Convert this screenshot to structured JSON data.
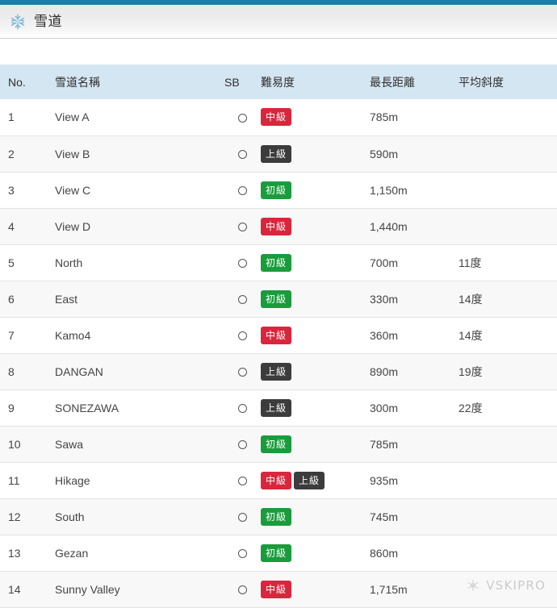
{
  "page": {
    "accent_color": "#1b7fa8",
    "section_title": "雪道",
    "section_icon": "snowflake-icon"
  },
  "table": {
    "columns": [
      {
        "key": "no",
        "label": "No."
      },
      {
        "key": "name",
        "label": "雪道名稱"
      },
      {
        "key": "sb",
        "label": "SB"
      },
      {
        "key": "diff",
        "label": "難易度"
      },
      {
        "key": "dist",
        "label": "最長距離"
      },
      {
        "key": "slope",
        "label": "平均斜度"
      }
    ],
    "header_bg": "#d4e6f2",
    "levels": {
      "beginner": {
        "label": "初級",
        "color": "#1a9c3c"
      },
      "intermediate": {
        "label": "中級",
        "color": "#d9263c"
      },
      "advanced": {
        "label": "上級",
        "color": "#3c3c3c"
      }
    },
    "sb_mark": "○",
    "rows": [
      {
        "no": "1",
        "name": "View A",
        "sb": "○",
        "levels": [
          "intermediate"
        ],
        "dist": "785m",
        "slope": ""
      },
      {
        "no": "2",
        "name": "View B",
        "sb": "○",
        "levels": [
          "advanced"
        ],
        "dist": "590m",
        "slope": ""
      },
      {
        "no": "3",
        "name": "View C",
        "sb": "○",
        "levels": [
          "beginner"
        ],
        "dist": "1,150m",
        "slope": ""
      },
      {
        "no": "4",
        "name": "View D",
        "sb": "○",
        "levels": [
          "intermediate"
        ],
        "dist": "1,440m",
        "slope": ""
      },
      {
        "no": "5",
        "name": "North",
        "sb": "○",
        "levels": [
          "beginner"
        ],
        "dist": "700m",
        "slope": "11度"
      },
      {
        "no": "6",
        "name": "East",
        "sb": "○",
        "levels": [
          "beginner"
        ],
        "dist": "330m",
        "slope": "14度"
      },
      {
        "no": "7",
        "name": "Kamo4",
        "sb": "○",
        "levels": [
          "intermediate"
        ],
        "dist": "360m",
        "slope": "14度"
      },
      {
        "no": "8",
        "name": "DANGAN",
        "sb": "○",
        "levels": [
          "advanced"
        ],
        "dist": "890m",
        "slope": "19度"
      },
      {
        "no": "9",
        "name": "SONEZAWA",
        "sb": "○",
        "levels": [
          "advanced"
        ],
        "dist": "300m",
        "slope": "22度"
      },
      {
        "no": "10",
        "name": "Sawa",
        "sb": "○",
        "levels": [
          "beginner"
        ],
        "dist": "785m",
        "slope": ""
      },
      {
        "no": "11",
        "name": "Hikage",
        "sb": "○",
        "levels": [
          "intermediate",
          "advanced"
        ],
        "dist": "935m",
        "slope": ""
      },
      {
        "no": "12",
        "name": "South",
        "sb": "○",
        "levels": [
          "beginner"
        ],
        "dist": "745m",
        "slope": ""
      },
      {
        "no": "13",
        "name": "Gezan",
        "sb": "○",
        "levels": [
          "beginner"
        ],
        "dist": "860m",
        "slope": ""
      },
      {
        "no": "14",
        "name": "Sunny Valley",
        "sb": "○",
        "levels": [
          "intermediate"
        ],
        "dist": "1,715m",
        "slope": ""
      }
    ]
  },
  "watermark": {
    "text": "VSKIPRO",
    "icon": "snowflake-watermark-icon"
  }
}
